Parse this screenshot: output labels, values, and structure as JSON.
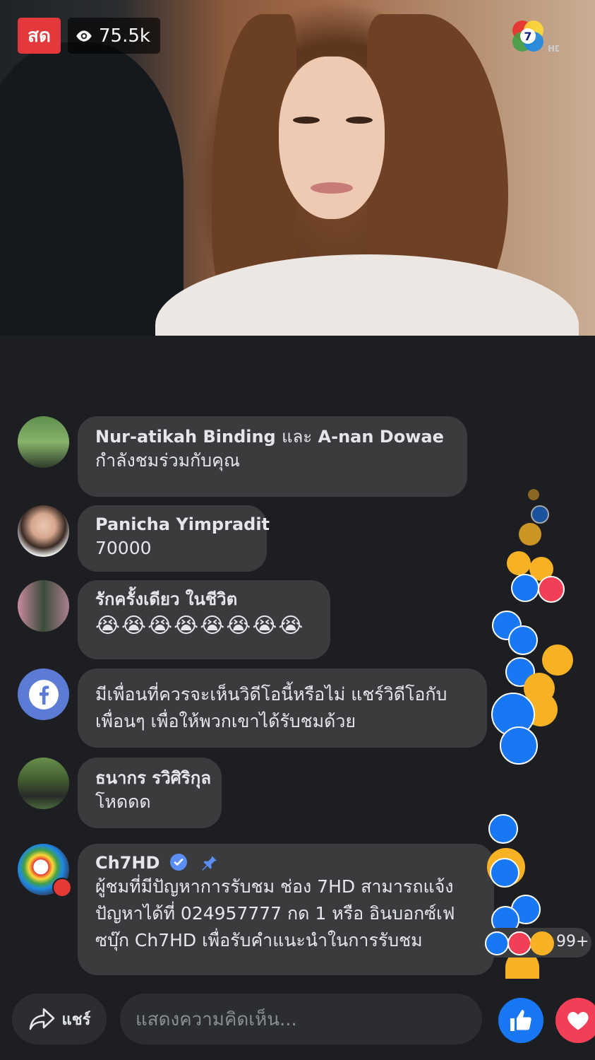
{
  "live": {
    "badge": "สด",
    "viewers": "75.5k"
  },
  "comments": [
    {
      "name": "Nur-atikah Binding",
      "connector": "และ",
      "name2": "A-nan Dowae",
      "text": "กำลังชมร่วมกับคุณ"
    },
    {
      "name": "Panicha Yimpradit",
      "text": "70000"
    },
    {
      "name": "รักครั้งเดียว ในชีวิต",
      "text": "😭😭😭😭😭😭😭😭"
    },
    {
      "text_line1": "มีเพื่อนที่ควรจะเห็นวิดีโอนี้หรือไม่ แชร์วิดีโอกับ",
      "text_line2": "เพื่อนๆ เพื่อให้พวกเขาได้รับชมด้วย"
    },
    {
      "name": "ธนากร รวิศิริกุล",
      "text": "โหดดด"
    },
    {
      "name": "Ch7HD",
      "text_line1": "ผู้ชมที่มีปัญหาการรับชม ช่อง 7HD สามารถแจ้ง",
      "text_line2": "ปัญหาได้ที่ 024957777 กด 1 หรือ อินบอกซ์เฟ",
      "text_line3": "ซบุ๊ก Ch7HD เพื่อรับคำแนะนำในการรับชม"
    }
  ],
  "reactions_count": "99+",
  "bottom_bar": {
    "share_label": "แชร์",
    "comment_placeholder": "แสดงความคิดเห็น..."
  },
  "colors": {
    "live": "#e4393c",
    "like": "#1877f2",
    "love": "#f33e58",
    "bubble": "#3a3b3c",
    "background": "#1c1e21"
  },
  "icons": [
    "eye-icon",
    "ch7-logo",
    "verified-icon",
    "pin-icon",
    "facebook-icon",
    "share-icon",
    "like-icon",
    "heart-icon"
  ]
}
